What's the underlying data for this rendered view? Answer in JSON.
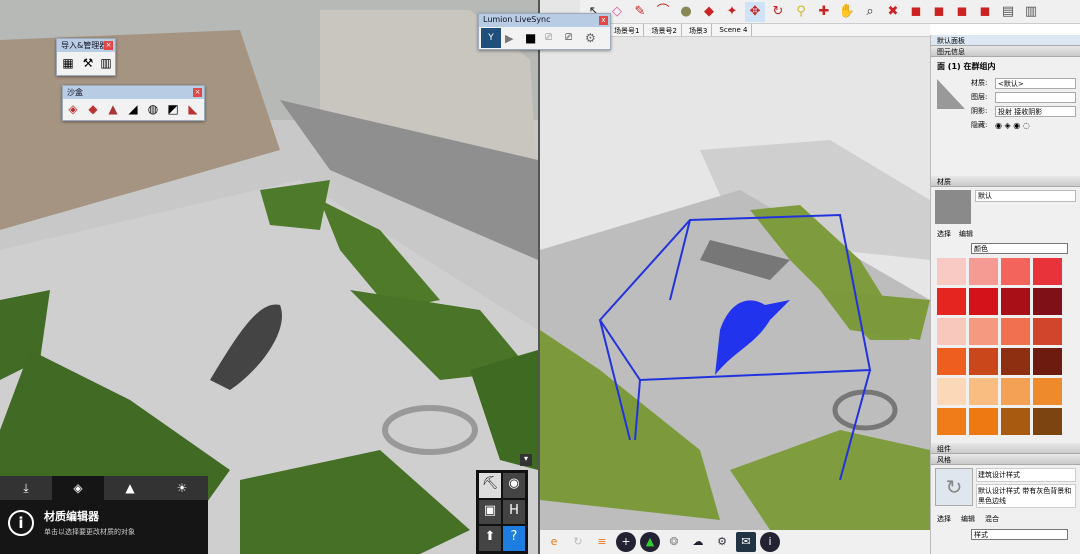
{
  "lumion": {
    "panel_1": {
      "title": "导入&管理器",
      "icons": [
        "grid-icon",
        "walk-icon",
        "door-icon"
      ]
    },
    "panel_2": {
      "title": "沙盒",
      "icons": [
        "sandbox-1",
        "sandbox-2",
        "sandbox-3",
        "sandbox-4",
        "sandbox-5",
        "sandbox-6",
        "sandbox-7"
      ]
    },
    "menu": {
      "tabs": [
        "weather",
        "materials",
        "landscape",
        "sun"
      ],
      "title": "材质编辑器",
      "subtitle": "单击以选择要更改材质的对象"
    },
    "tools": [
      "walk",
      "camera",
      "save",
      "ruler",
      "upload",
      "help"
    ],
    "help_label": "?"
  },
  "livesync": {
    "title": "Lumion LiveSync",
    "close": "x"
  },
  "sketchup": {
    "scenes": [
      "场景号1",
      "场景号2",
      "场景3",
      "Scene 4"
    ],
    "tray": {
      "title": "默认面板",
      "entity_section": "图元信息",
      "entity_name": "面 (1) 在群组内",
      "fields": [
        {
          "label": "材质:",
          "value": "<默认>"
        },
        {
          "label": "图层:",
          "value": ""
        },
        {
          "label": "阴影:",
          "value": "投射 接收阴影"
        },
        {
          "label": "隐藏:",
          "value": ""
        }
      ],
      "materials_section": "材质",
      "material_name": "默认",
      "material_tabs": [
        "选择",
        "编辑"
      ],
      "material_dropdown": "颜色",
      "swatch_colors": [
        "#f9c9c4",
        "#f69b93",
        "#f2645c",
        "#e8333a",
        "#e52520",
        "#d4121a",
        "#a80f17",
        "#801018",
        "#f8c8bc",
        "#f59a81",
        "#f07050",
        "#d0452c",
        "#ee5e1e",
        "#c9471a",
        "#8f2f12",
        "#6c1b0e",
        "#fbd9b8",
        "#f9bd82",
        "#f4a055",
        "#ee8a2c",
        "#f07c19",
        "#ee7811",
        "#a85b10",
        "#7c4410"
      ],
      "components_section": "组件",
      "styles_section": "风格",
      "style_name": "建筑设计样式",
      "style_desc": "默认设计样式 带有灰色背景和黑色边线",
      "style_tabs": [
        "选择",
        "编辑",
        "混合"
      ],
      "style_dropdown": "样式"
    }
  }
}
